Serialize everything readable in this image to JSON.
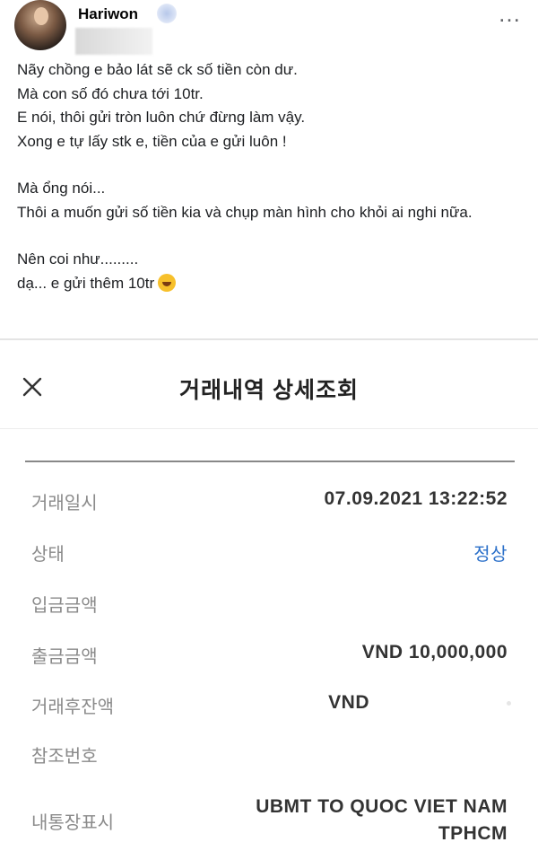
{
  "post": {
    "author": "Hariwon",
    "more_icon": "…",
    "lines": [
      "Nãy chồng e bảo lát sẽ ck số tiền còn dư.",
      "Mà con số đó chưa tới 10tr.",
      "E nói, thôi gửi tròn luôn chứ đừng làm vậy.",
      "Xong e tự lấy stk e, tiền của e gửi luôn !",
      "Mà ổng nói...",
      "Thôi a muốn gửi số tiền kia và chụp màn hình cho  khỏi ai nghi nữa.",
      "Nên coi như.........",
      "dạ... e gửi thêm 10tr"
    ],
    "emoji": "rolling-on-floor-laughing"
  },
  "app": {
    "title": "거래내역 상세조회",
    "close_icon": "close-icon",
    "rows": [
      {
        "label": "거래일시",
        "value": "07.09.2021  13:22:52"
      },
      {
        "label": "상태",
        "value": "정상"
      },
      {
        "label": "입금금액",
        "value": ""
      },
      {
        "label": "출금금액",
        "value": "VND  10,000,000"
      },
      {
        "label": "거래후잔액",
        "value": "VND"
      },
      {
        "label": "참조번호",
        "value": ""
      },
      {
        "label": "내통장표시",
        "value_line1": "UBMT TO QUOC VIET NAM",
        "value_line2": "TPHCM"
      }
    ],
    "status_color": "#2a6fc9"
  }
}
